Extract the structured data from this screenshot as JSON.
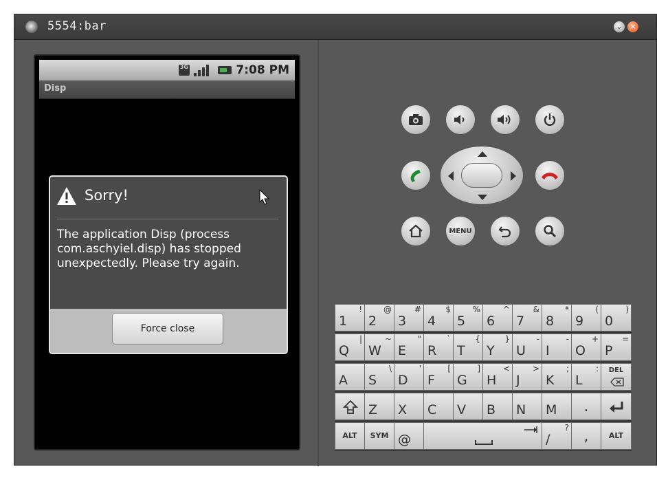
{
  "window": {
    "title": "5554:bar"
  },
  "status_bar": {
    "time": "7:08 PM",
    "network_label": "3G"
  },
  "app_bar": {
    "title": "Disp"
  },
  "dialog": {
    "title": "Sorry!",
    "message": "The application Disp (process com.aschyiel.disp) has stopped unexpectedly. Please try again.",
    "button_label": "Force close"
  },
  "controls": {
    "row1": [
      "camera-icon",
      "volume-down-icon",
      "volume-up-icon",
      "power-icon"
    ],
    "row2": [
      "call-icon",
      "dpad",
      "end-call-icon"
    ],
    "row3": [
      "home-icon",
      "menu",
      "back-icon",
      "search-icon"
    ],
    "menu_label": "MENU"
  },
  "keyboard": {
    "row1": [
      {
        "main": "1",
        "alt": "!"
      },
      {
        "main": "2",
        "alt": "@"
      },
      {
        "main": "3",
        "alt": "#"
      },
      {
        "main": "4",
        "alt": "$"
      },
      {
        "main": "5",
        "alt": "%"
      },
      {
        "main": "6",
        "alt": "^"
      },
      {
        "main": "7",
        "alt": "&"
      },
      {
        "main": "8",
        "alt": "*"
      },
      {
        "main": "9",
        "alt": "("
      },
      {
        "main": "0",
        "alt": ")"
      }
    ],
    "row2": [
      {
        "main": "Q",
        "alt": "|"
      },
      {
        "main": "W",
        "alt": "~"
      },
      {
        "main": "E",
        "alt": "\""
      },
      {
        "main": "R",
        "alt": "`"
      },
      {
        "main": "T",
        "alt": "{"
      },
      {
        "main": "Y",
        "alt": "}"
      },
      {
        "main": "U",
        "alt": "-"
      },
      {
        "main": "I",
        "alt": "-"
      },
      {
        "main": "O",
        "alt": "+"
      },
      {
        "main": "P",
        "alt": "="
      }
    ],
    "row3": [
      {
        "main": "A",
        "alt": ""
      },
      {
        "main": "S",
        "alt": "\\"
      },
      {
        "main": "D",
        "alt": "'"
      },
      {
        "main": "F",
        "alt": "["
      },
      {
        "main": "G",
        "alt": "]"
      },
      {
        "main": "H",
        "alt": "<"
      },
      {
        "main": "J",
        "alt": ">"
      },
      {
        "main": "K",
        "alt": ";"
      },
      {
        "main": "L",
        "alt": ":"
      },
      {
        "main": "DEL",
        "alt": ""
      }
    ],
    "row4": [
      {
        "main": "shift-icon",
        "alt": ""
      },
      {
        "main": "Z",
        "alt": ""
      },
      {
        "main": "X",
        "alt": ""
      },
      {
        "main": "C",
        "alt": ""
      },
      {
        "main": "V",
        "alt": ""
      },
      {
        "main": "B",
        "alt": ""
      },
      {
        "main": "N",
        "alt": ""
      },
      {
        "main": "M",
        "alt": ""
      },
      {
        "main": ".",
        "alt": ""
      },
      {
        "main": "enter-icon",
        "alt": ""
      }
    ],
    "row5": [
      {
        "main": "ALT"
      },
      {
        "main": "SYM"
      },
      {
        "main": "@"
      },
      {
        "main": "space-icon"
      },
      {
        "main": "/",
        "alt": "?"
      },
      {
        "main": ","
      },
      {
        "main": "ALT"
      }
    ]
  }
}
